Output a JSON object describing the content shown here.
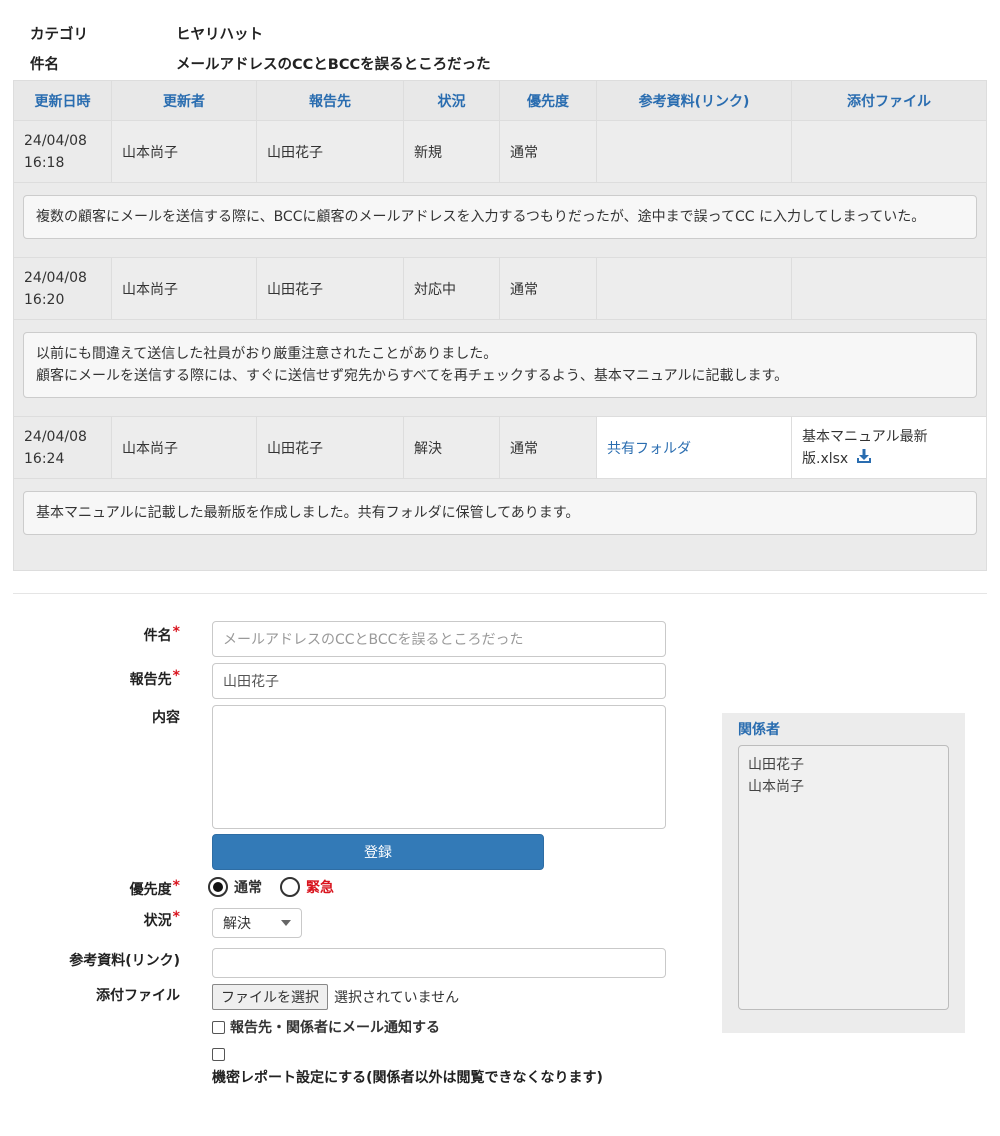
{
  "meta": {
    "category_label": "カテゴリ",
    "category_value": "ヒヤリハット",
    "subject_label": "件名",
    "subject_value": "メールアドレスのCCとBCCを誤るところだった"
  },
  "history": {
    "columns": [
      "更新日時",
      "更新者",
      "報告先",
      "状況",
      "優先度",
      "参考資料(リンク)",
      "添付ファイル"
    ],
    "entries": [
      {
        "date": "24/04/08",
        "time": "16:18",
        "updater": "山本尚子",
        "reporter": "山田花子",
        "status": "新規",
        "priority": "通常",
        "link": "",
        "file": "",
        "comment": "複数の顧客にメールを送信する際に、BCCに顧客のメールアドレスを入力するつもりだったが、途中まで誤ってCC に入力してしまっていた。"
      },
      {
        "date": "24/04/08",
        "time": "16:20",
        "updater": "山本尚子",
        "reporter": "山田花子",
        "status": "対応中",
        "priority": "通常",
        "link": "",
        "file": "",
        "comment_line1": "以前にも間違えて送信した社員がおり厳重注意されたことがありました。",
        "comment_line2": "顧客にメールを送信する際には、すぐに送信せず宛先からすべてを再チェックするよう、基本マニュアルに記載します。"
      },
      {
        "date": "24/04/08",
        "time": "16:24",
        "updater": "山本尚子",
        "reporter": "山田花子",
        "status": "解決",
        "priority": "通常",
        "link": "共有フォルダ",
        "file_line1": "基本マニュアル最新",
        "file_line2": "版.xlsx",
        "comment": "基本マニュアルに記載した最新版を作成しました。共有フォルダに保管してあります。"
      }
    ]
  },
  "form": {
    "subject_label": "件名",
    "subject_placeholder": "メールアドレスのCCとBCCを誤るところだった",
    "reporter_label": "報告先",
    "reporter_value": "山田花子",
    "content_label": "内容",
    "submit_label": "登録",
    "priority_label": "優先度",
    "priority_normal": "通常",
    "priority_urgent": "緊急",
    "status_label": "状況",
    "status_value": "解決",
    "link_label": "参考資料(リンク)",
    "file_label": "添付ファイル",
    "file_button": "ファイルを選択",
    "file_none": "選択されていません",
    "notify_label": "報告先・関係者にメール通知する",
    "confidential_label": "機密レポート設定にする(関係者以外は閲覧できなくなります)",
    "required_mark": "*"
  },
  "related": {
    "title": "関係者",
    "people": [
      "山田花子",
      "山本尚子"
    ]
  },
  "colors": {
    "accent": "#2a6db0",
    "button": "#337ab7",
    "required": "#d9141e"
  }
}
